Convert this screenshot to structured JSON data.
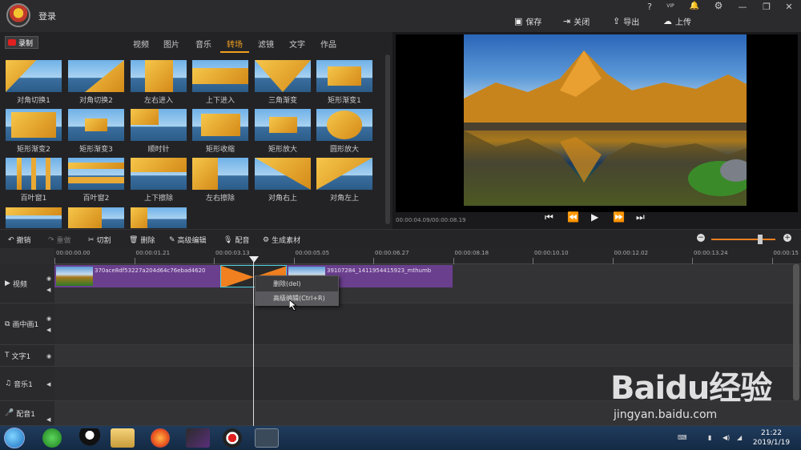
{
  "header": {
    "login": "登录",
    "window_controls": [
      "?",
      "VIP",
      "🔔",
      "⚙",
      "—",
      "❐",
      "✕"
    ],
    "actions": [
      {
        "icon": "save-icon",
        "label": "保存"
      },
      {
        "icon": "close-doc-icon",
        "label": "关闭"
      },
      {
        "icon": "export-icon",
        "label": "导出"
      },
      {
        "icon": "upload-icon",
        "label": "上传"
      }
    ]
  },
  "library": {
    "record_label": "录制",
    "tabs": [
      "视频",
      "图片",
      "音乐",
      "转场",
      "滤镜",
      "文字",
      "作品"
    ],
    "active_tab": "转场",
    "transitions": [
      "对角切换1",
      "对角切换2",
      "左右进入",
      "上下进入",
      "三角渐变",
      "矩形渐变1",
      "矩形渐变2",
      "矩形渐变3",
      "顺时针",
      "矩形收缩",
      "矩形放大",
      "圆形放大",
      "百叶窗1",
      "百叶窗2",
      "上下擦除",
      "左右擦除",
      "对角右上",
      "对角左上"
    ]
  },
  "preview": {
    "time": "00:00:04.09/00:00:08.19"
  },
  "toolbar": {
    "undo": "撤销",
    "redo": "重做",
    "cut": "切割",
    "delete": "删除",
    "advanced_edit": "高级编辑",
    "dub": "配音",
    "generate": "生成素材"
  },
  "timeline": {
    "ticks": [
      "00:00:00.00",
      "00:00:01.21",
      "00:00:03.13",
      "00:00:05.05",
      "00:00:06.27",
      "00:00:08.18",
      "00:00:10.10",
      "00:00:12.02",
      "00:00:13.24",
      "00:00:15"
    ],
    "tracks": [
      "视频",
      "画中画1",
      "文字1",
      "音乐1",
      "配音1"
    ],
    "clip1_name": "370ace8df53227a204d64c76ebad4620",
    "clip2_name": "39107284_1411954415923_mthumb"
  },
  "context_menu": {
    "items": [
      "删除(del)",
      "高级编辑(Ctrl+R)"
    ]
  },
  "taskbar": {
    "time": "21:22",
    "date": "2019/1/19"
  },
  "watermark": {
    "brand": "Baidu经验",
    "url": "jingyan.baidu.com"
  }
}
